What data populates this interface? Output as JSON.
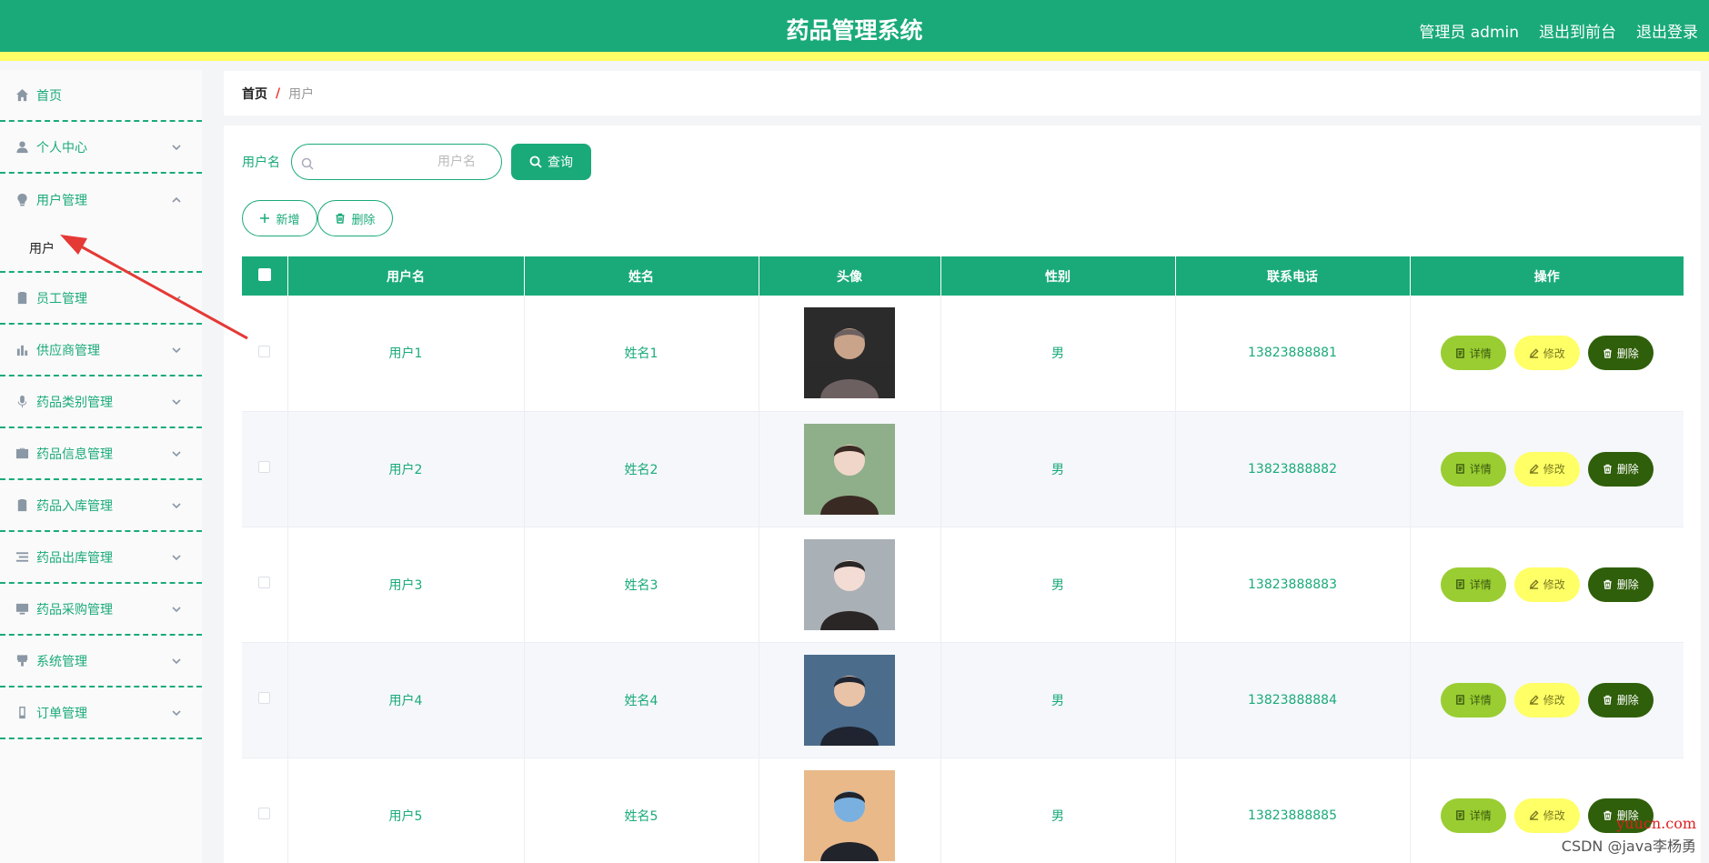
{
  "header": {
    "title": "药品管理系统",
    "user_label": "管理员 admin",
    "to_front_label": "退出到前台",
    "logout_label": "退出登录"
  },
  "sidebar": {
    "items": [
      {
        "label": "首页",
        "icon": "home-icon"
      },
      {
        "label": "个人中心",
        "icon": "user-icon"
      },
      {
        "label": "用户管理",
        "icon": "bulb-icon",
        "submenu": [
          {
            "label": "用户"
          }
        ]
      },
      {
        "label": "员工管理",
        "icon": "clipboard-x-icon"
      },
      {
        "label": "供应商管理",
        "icon": "bar-chart-icon"
      },
      {
        "label": "药品类别管理",
        "icon": "microphone-icon"
      },
      {
        "label": "药品信息管理",
        "icon": "briefcase-icon"
      },
      {
        "label": "药品入库管理",
        "icon": "clipboard-check-icon"
      },
      {
        "label": "药品出库管理",
        "icon": "list-icon"
      },
      {
        "label": "药品采购管理",
        "icon": "monitor-icon"
      },
      {
        "label": "系统管理",
        "icon": "brush-icon"
      },
      {
        "label": "订单管理",
        "icon": "mobile-icon"
      }
    ]
  },
  "breadcrumb": {
    "home": "首页",
    "separator": "/",
    "current": "用户"
  },
  "search": {
    "label": "用户名",
    "placeholder": "用户名",
    "button": "查询"
  },
  "actions": {
    "add": "新增",
    "delete": "删除"
  },
  "table": {
    "columns": [
      "用户名",
      "姓名",
      "头像",
      "性别",
      "联系电话",
      "操作"
    ],
    "rows": [
      {
        "username": "用户1",
        "name": "姓名1",
        "gender": "男",
        "phone": "13823888881"
      },
      {
        "username": "用户2",
        "name": "姓名2",
        "gender": "男",
        "phone": "13823888882"
      },
      {
        "username": "用户3",
        "name": "姓名3",
        "gender": "男",
        "phone": "13823888883"
      },
      {
        "username": "用户4",
        "name": "姓名4",
        "gender": "男",
        "phone": "13823888884"
      },
      {
        "username": "用户5",
        "name": "姓名5",
        "gender": "男",
        "phone": "13823888885"
      }
    ],
    "op_labels": {
      "detail": "详情",
      "edit": "修改",
      "delete": "删除"
    }
  },
  "watermark": {
    "csdn": "CSDN @java李杨勇",
    "site": "yuucn.com"
  },
  "colors": {
    "primary": "#1aaa7a",
    "accent_yellow": "#ffff66",
    "detail": "#9acd32",
    "delete_dark": "#2f5f0a",
    "arrow": "#e53935"
  }
}
